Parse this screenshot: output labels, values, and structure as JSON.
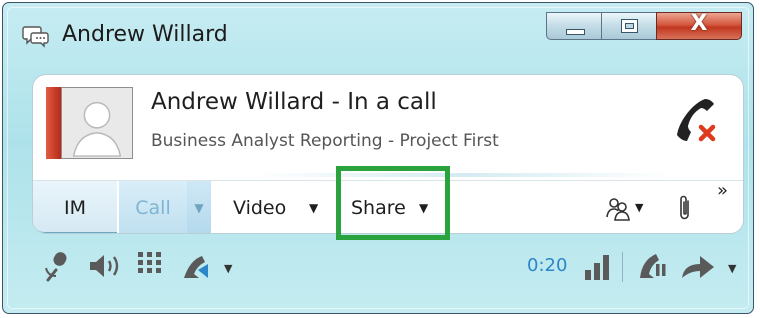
{
  "window": {
    "title": "Andrew Willard",
    "controls": {
      "close_glyph": "X"
    }
  },
  "contact": {
    "name_status": "Andrew Willard - In a call",
    "subtitle": "Business Analyst Reporting - Project First"
  },
  "tabs": {
    "im": "IM",
    "call": "Call",
    "video": "Video",
    "share": "Share",
    "caret": "▼",
    "overflow": "»"
  },
  "call_controls": {
    "timer": "0:20"
  },
  "colors": {
    "accent_blue": "#2b87c9",
    "highlight_green": "#2aa33e",
    "end_call_red": "#e03a1c"
  },
  "icons": [
    "chat-window-icon",
    "minimize-icon",
    "maximize-icon",
    "close-icon",
    "avatar-icon",
    "end-call-icon",
    "people-icon",
    "paperclip-icon",
    "microphone-icon",
    "speaker-icon",
    "dialpad-icon",
    "call-device-icon",
    "signal-bars-icon",
    "hold-call-icon",
    "transfer-icon"
  ]
}
